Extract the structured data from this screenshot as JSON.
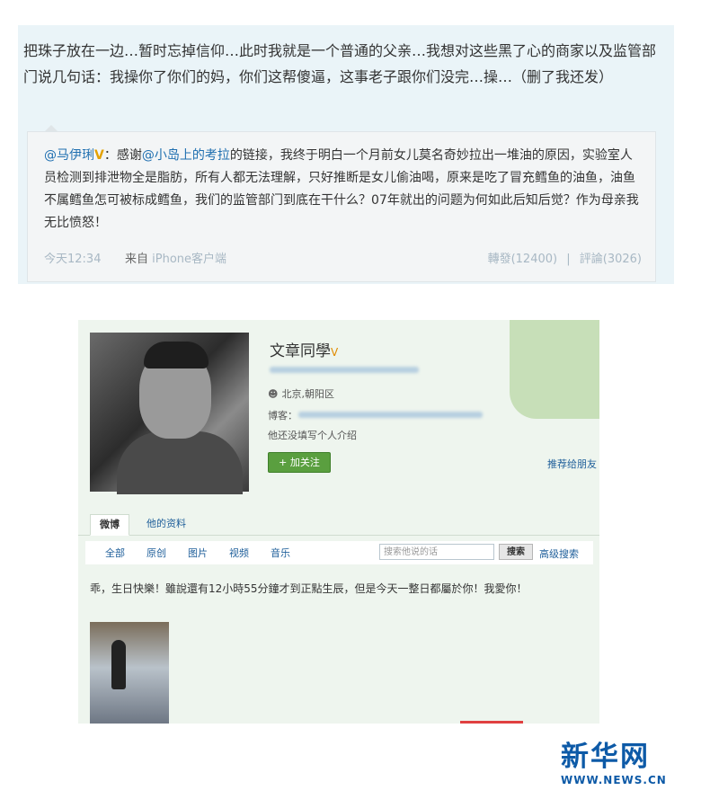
{
  "post": {
    "text": "把珠子放在一边…暂时忘掉信仰…此时我就是一个普通的父亲…我想对这些黑了心的商家以及监管部门说几句话：我操你了你们的妈，你们这帮傻逼，这事老子跟你们没完…操…（删了我还发）"
  },
  "repost": {
    "author": "@马伊琍",
    "text_mid": "：感谢",
    "mention": "@小岛上的考拉",
    "body": "的链接，我终于明白一个月前女儿莫名奇妙拉出一堆油的原因，实验室人员检测到排泄物全是脂肪，所有人都无法理解，只好推断是女儿偷油喝，原来是吃了冒充鳕鱼的油鱼，油鱼不属鳕鱼怎可被标成鳕鱼，我们的监管部门到底在干什么？07年就出的问题为何如此后知后觉？作为母亲我无比愤怒！",
    "time": "今天12:34",
    "source_label": "来自",
    "source": "iPhone客户端",
    "forward": "轉發(12400)",
    "divider": "|",
    "comment": "評論(3026)"
  },
  "profile": {
    "name": "文章同學",
    "location": "北京,朝阳区",
    "blog_label": "博客：",
    "intro": "他还没填写个人介绍",
    "follow_button": "+ 加关注",
    "recommend": "推荐给朋友",
    "tabs": [
      {
        "label": "微博"
      },
      {
        "label": "他的资料"
      }
    ],
    "subnav": [
      {
        "label": "全部"
      },
      {
        "label": "原创"
      },
      {
        "label": "图片"
      },
      {
        "label": "视频"
      },
      {
        "label": "音乐"
      }
    ],
    "search_placeholder": "搜索他说的话",
    "search_button": "搜索",
    "advanced_search": "高级搜索",
    "tweet": "乖，生日快樂！雖說還有12小時55分鐘才到正點生辰，但是今天一整日都屬於你！我愛你！"
  },
  "logo": {
    "name": "新华网",
    "url": "WWW.NEWS.CN"
  },
  "colors": {
    "card_bg": "#eaf4f8",
    "link": "#1f6fb0",
    "follow": "#5a9f3f",
    "brand": "#0d5aa7"
  }
}
